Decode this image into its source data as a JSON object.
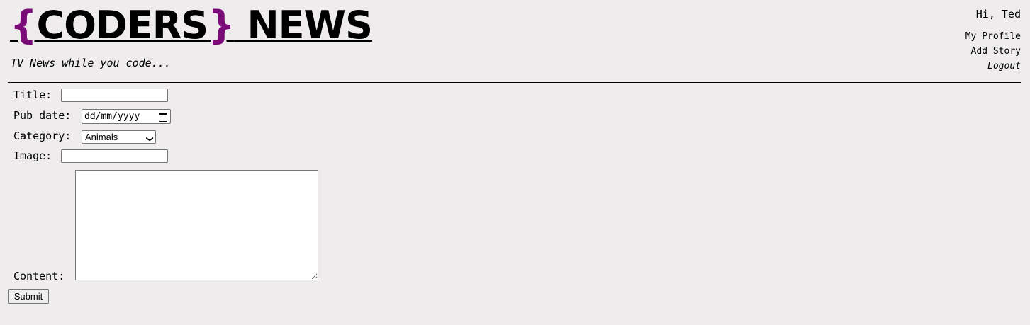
{
  "header": {
    "logo": {
      "brace_open": "{",
      "name": "CODERS",
      "brace_close": "}",
      "suffix": " NEWS"
    },
    "tagline": "TV News while you code...",
    "greeting": "Hi, Ted",
    "nav": [
      {
        "label": "My Profile"
      },
      {
        "label": "Add Story"
      },
      {
        "label": "Logout"
      }
    ]
  },
  "form": {
    "title_label": "Title:",
    "title_value": "",
    "pubdate_label": "Pub date:",
    "pubdate_placeholder": "dd/mm/yyyy",
    "category_label": "Category:",
    "category_value": "Animals",
    "image_label": "Image:",
    "image_value": "",
    "content_label": "Content:",
    "content_value": "",
    "submit_label": "Submit"
  },
  "colors": {
    "brand_accent": "#7a0a78",
    "background": "#eeecec"
  },
  "icons": {
    "date": "calendar-icon",
    "select": "chevron-down-icon"
  }
}
